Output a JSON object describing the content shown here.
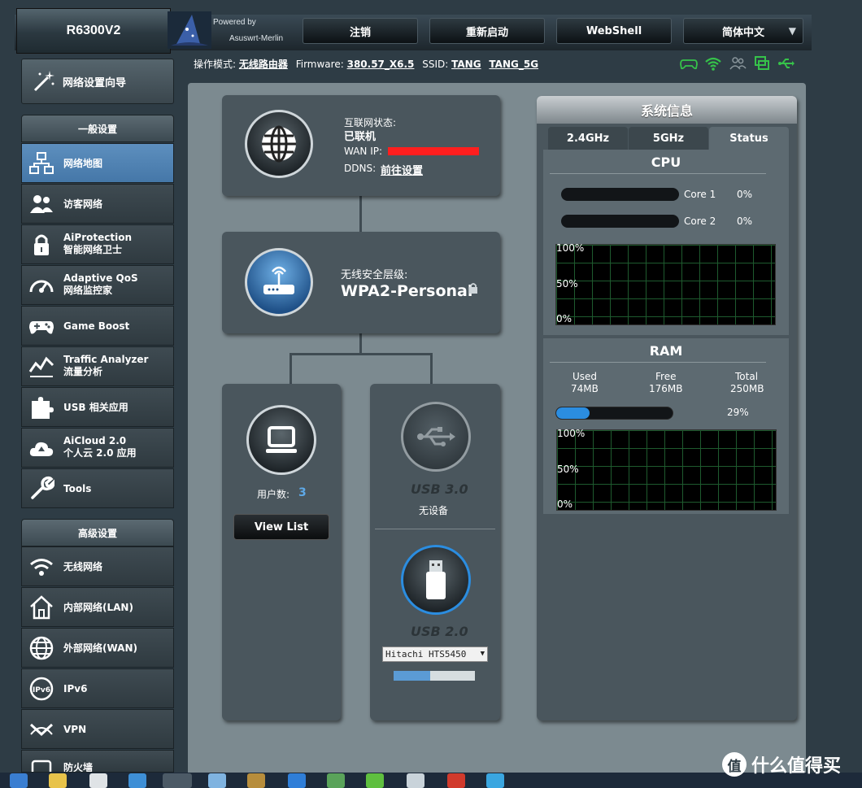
{
  "header": {
    "model": "R6300V2",
    "powered_by": "Powered by",
    "firmware_brand": "Asuswrt-Merlin",
    "buttons": {
      "logout": "注销",
      "reboot": "重新启动",
      "webshell": "WebShell",
      "language": "简体中文"
    }
  },
  "statusline": {
    "mode_label": "操作模式:",
    "mode_value": "无线路由器",
    "firmware_label": "Firmware:",
    "firmware_value": "380.57_X6.5",
    "ssid_label": "SSID:",
    "ssid_1": "TANG",
    "ssid_2": "TANG_5G"
  },
  "sidebar": {
    "wizard": "网络设置向导",
    "general_head": "一般设置",
    "advanced_head": "高级设置",
    "general_items": [
      {
        "label": "网络地图"
      },
      {
        "label": "访客网络"
      },
      {
        "label": "AiProtection",
        "label2": "智能网络卫士"
      },
      {
        "label": "Adaptive QoS",
        "label2": "网络监控家"
      },
      {
        "label": "Game Boost"
      },
      {
        "label": "Traffic Analyzer",
        "label2": "流量分析"
      },
      {
        "label": "USB 相关应用"
      },
      {
        "label": "AiCloud 2.0",
        "label2": "个人云 2.0 应用"
      },
      {
        "label": "Tools"
      }
    ],
    "advanced_items": [
      {
        "label": "无线网络"
      },
      {
        "label": "内部网络(LAN)"
      },
      {
        "label": "外部网络(WAN)"
      },
      {
        "label": "IPv6"
      },
      {
        "label": "VPN"
      },
      {
        "label": "防火墙"
      }
    ]
  },
  "internet": {
    "status_label": "互联网状态:",
    "status_value": "已联机",
    "wan_label": "WAN IP:",
    "ddns_label": "DDNS:",
    "ddns_link": "前往设置"
  },
  "router": {
    "security_label": "无线安全层级:",
    "security_value": "WPA2-Personal"
  },
  "clients": {
    "count_label": "用户数:",
    "count_value": "3",
    "view_list": "View List"
  },
  "usb": {
    "usb3_label": "USB 3.0",
    "usb3_status": "无设备",
    "usb2_label": "USB 2.0",
    "usb2_device": "Hitachi HTS5450",
    "usb2_fill": 0.45
  },
  "sysinfo": {
    "title": "系统信息",
    "tabs": [
      "2.4GHz",
      "5GHz",
      "Status"
    ],
    "active_tab": "Status",
    "cpu_title": "CPU",
    "cores": [
      {
        "name": "Core 1",
        "value": "0%"
      },
      {
        "name": "Core 2",
        "value": "0%"
      }
    ],
    "cpu_axis": [
      "100%",
      "50%",
      "0%"
    ],
    "ram_title": "RAM",
    "ram_cols": [
      {
        "label": "Used",
        "value": "74MB"
      },
      {
        "label": "Free",
        "value": "176MB"
      },
      {
        "label": "Total",
        "value": "250MB"
      }
    ],
    "ram_percent": "29%",
    "ram_fill": 0.29,
    "ram_axis": [
      "100%",
      "50%",
      "0%"
    ]
  },
  "watermark": "什么值得买",
  "colors": {
    "accent_green": "#36c24a",
    "accent_blue": "#2b8de0",
    "active_nav": "#4f83b4",
    "wan_redacted": "#ff1e1e"
  }
}
